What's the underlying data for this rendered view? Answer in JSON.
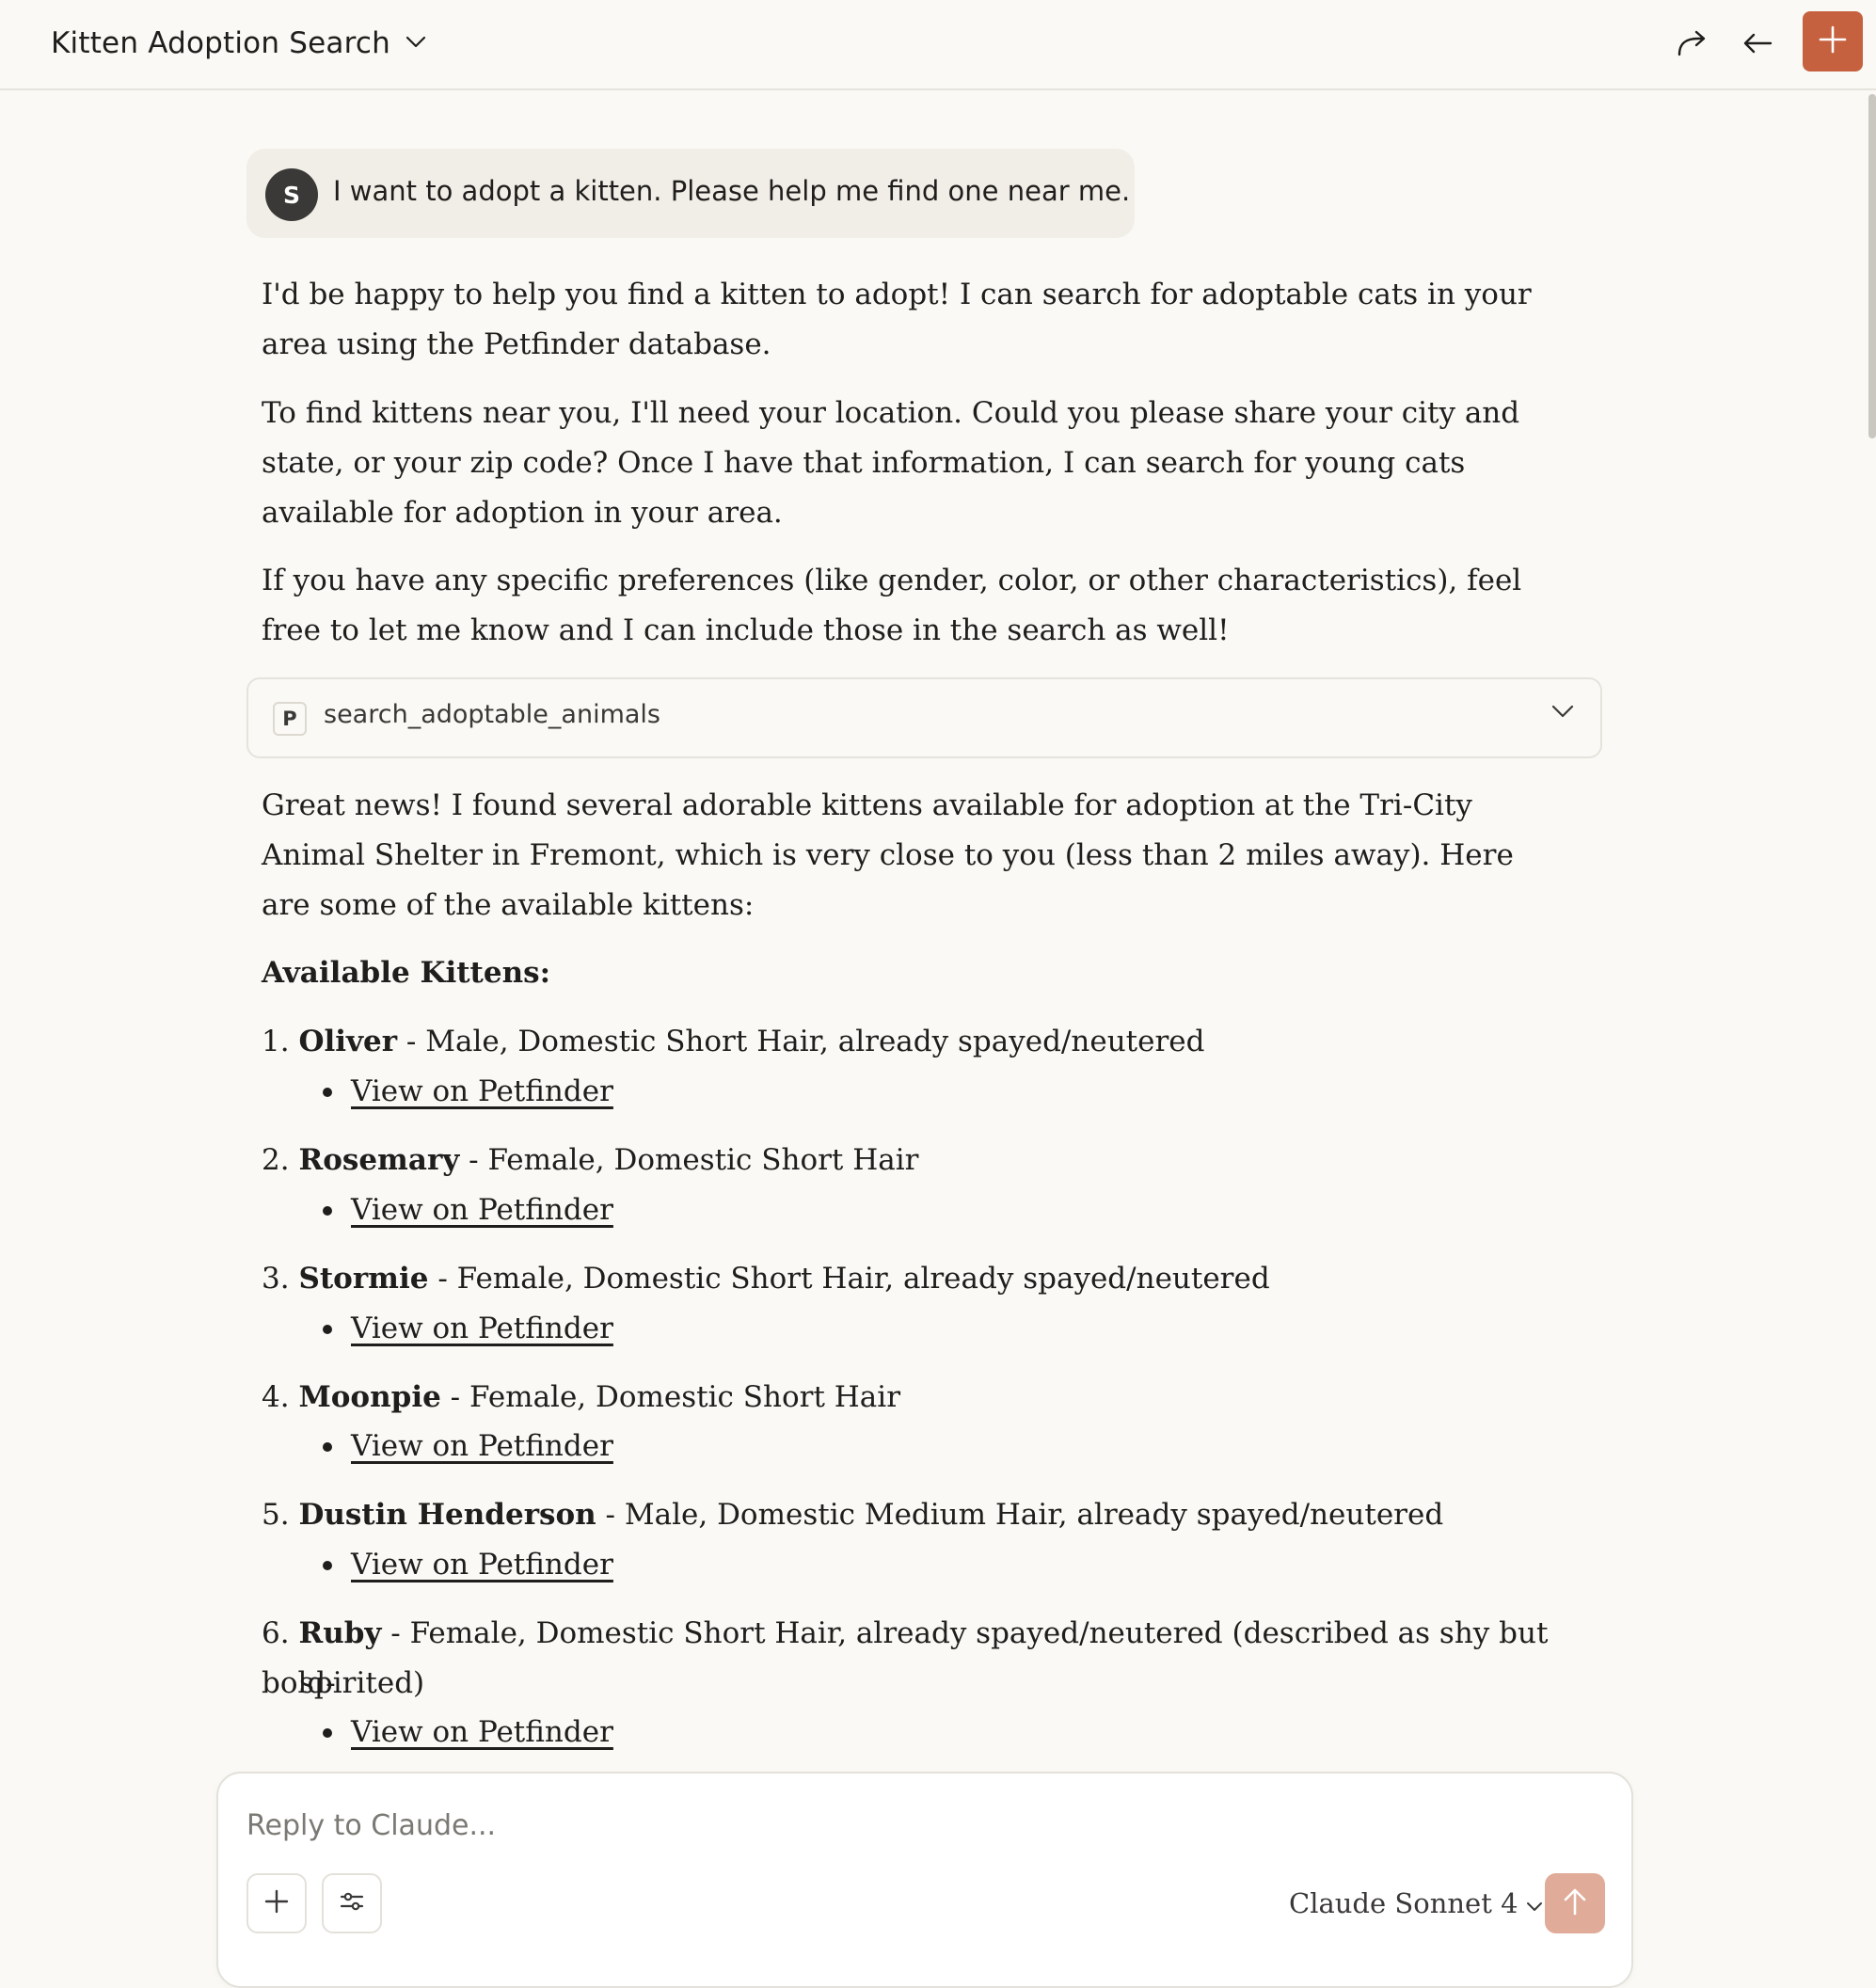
{
  "header": {
    "title": "Kitten Adoption Search"
  },
  "user_message": {
    "avatar_initial": "S",
    "text": "I want to adopt a kitten. Please help me find one near me."
  },
  "assistant_intro": [
    "I'd be happy to help you find a kitten to adopt! I can search for adoptable cats in your area using the Petfinder database.",
    "To find kittens near you, I'll need your location. Could you please share your city and state, or your zip code? Once I have that information, I can search for young cats available for adoption in your area.",
    "If you have any specific preferences (like gender, color, or other characteristics), feel free to let me know and I can include those in the search as well!"
  ],
  "tool_call": {
    "badge": "P",
    "name": "search_adoptable_animals"
  },
  "results_intro": "Great news! I found several adorable kittens available for adoption at the Tri-City Animal Shelter in Fremont, which is very close to you (less than 2 miles away). Here are some of the available kittens:",
  "results_heading": "Available Kittens:",
  "kittens": [
    {
      "num": "1.",
      "name": "Oliver",
      "desc": " - Male, Domestic Short Hair, already spayed/neutered",
      "link": "View on Petfinder"
    },
    {
      "num": "2.",
      "name": "Rosemary",
      "desc": " - Female, Domestic Short Hair",
      "link": "View on Petfinder"
    },
    {
      "num": "3.",
      "name": "Stormie",
      "desc": " - Female, Domestic Short Hair, already spayed/neutered",
      "link": "View on Petfinder"
    },
    {
      "num": "4.",
      "name": "Moonpie",
      "desc": " - Female, Domestic Short Hair",
      "link": "View on Petfinder"
    },
    {
      "num": "5.",
      "name": "Dustin Henderson",
      "desc": " - Male, Domestic Medium Hair, already spayed/neutered",
      "link": "View on Petfinder"
    },
    {
      "num": "6.",
      "name": "Ruby",
      "desc": " - Female, Domestic Short Hair, already spayed/neutered (described as shy but bold-",
      "desc2": "spirited)",
      "link": "View on Petfinder"
    }
  ],
  "composer": {
    "placeholder": "Reply to Claude...",
    "model": "Claude Sonnet 4"
  },
  "colors": {
    "accent": "#c6613f",
    "send_disabled": "#e0ab98",
    "background": "#faf9f5",
    "user_bubble": "#f0eee6"
  }
}
